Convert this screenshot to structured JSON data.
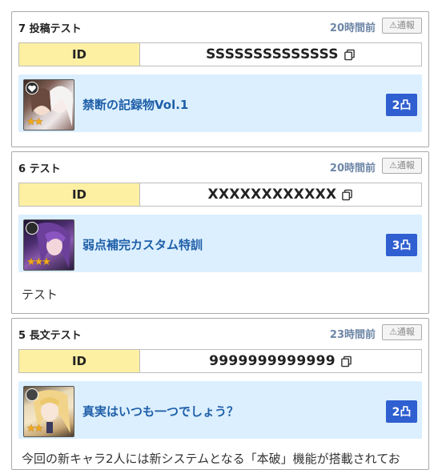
{
  "posts": [
    {
      "title": "7 投稿テスト",
      "time": "20時間前",
      "report": "⚠通報",
      "id_label": "ID",
      "id_value": "SSSSSSSSSSSSSS",
      "deck_name": "禁断の記録物Vol.1",
      "badge": "2凸",
      "stars": "★★",
      "comment": ""
    },
    {
      "title": "6 テスト",
      "time": "20時間前",
      "report": "⚠通報",
      "id_label": "ID",
      "id_value": "XXXXXXXXXXXX",
      "deck_name": "弱点補完カスタム特訓",
      "badge": "3凸",
      "stars": "★★★",
      "comment": "テスト"
    },
    {
      "title": "5 長文テスト",
      "time": "23時間前",
      "report": "⚠通報",
      "id_label": "ID",
      "id_value": "9999999999999",
      "deck_name": "真実はいつも一つでしょう？",
      "badge": "2凸",
      "stars": "★★",
      "comment": "今回の新キャラ2人には新システムとなる「本破」機能が搭載されてお"
    }
  ],
  "colors": {
    "id_label_bg": "#fdf0a3",
    "deck_bg": "#dcefff",
    "badge_bg": "#2f5fd0",
    "deck_name": "#1e5fa8",
    "time": "#6d86a6"
  },
  "icons": [
    "copy-icon",
    "warning-icon",
    "heart-icon",
    "star-icon"
  ]
}
